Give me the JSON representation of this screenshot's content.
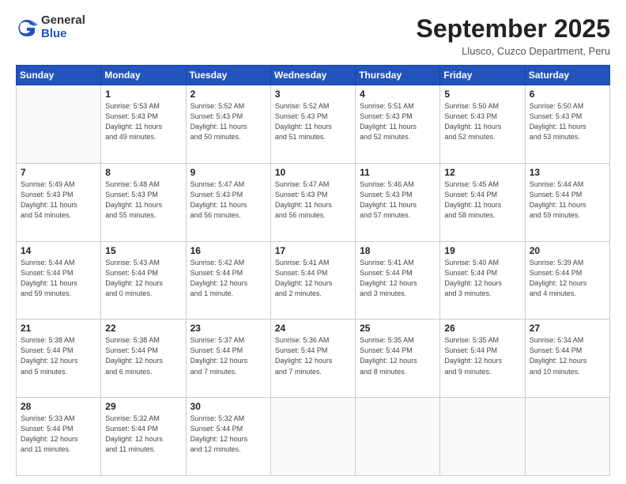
{
  "logo": {
    "general": "General",
    "blue": "Blue"
  },
  "header": {
    "month_title": "September 2025",
    "location": "Llusco, Cuzco Department, Peru"
  },
  "weekdays": [
    "Sunday",
    "Monday",
    "Tuesday",
    "Wednesday",
    "Thursday",
    "Friday",
    "Saturday"
  ],
  "weeks": [
    [
      {
        "day": "",
        "info": ""
      },
      {
        "day": "1",
        "info": "Sunrise: 5:53 AM\nSunset: 5:43 PM\nDaylight: 11 hours\nand 49 minutes."
      },
      {
        "day": "2",
        "info": "Sunrise: 5:52 AM\nSunset: 5:43 PM\nDaylight: 11 hours\nand 50 minutes."
      },
      {
        "day": "3",
        "info": "Sunrise: 5:52 AM\nSunset: 5:43 PM\nDaylight: 11 hours\nand 51 minutes."
      },
      {
        "day": "4",
        "info": "Sunrise: 5:51 AM\nSunset: 5:43 PM\nDaylight: 11 hours\nand 52 minutes."
      },
      {
        "day": "5",
        "info": "Sunrise: 5:50 AM\nSunset: 5:43 PM\nDaylight: 11 hours\nand 52 minutes."
      },
      {
        "day": "6",
        "info": "Sunrise: 5:50 AM\nSunset: 5:43 PM\nDaylight: 11 hours\nand 53 minutes."
      }
    ],
    [
      {
        "day": "7",
        "info": "Sunrise: 5:49 AM\nSunset: 5:43 PM\nDaylight: 11 hours\nand 54 minutes."
      },
      {
        "day": "8",
        "info": "Sunrise: 5:48 AM\nSunset: 5:43 PM\nDaylight: 11 hours\nand 55 minutes."
      },
      {
        "day": "9",
        "info": "Sunrise: 5:47 AM\nSunset: 5:43 PM\nDaylight: 11 hours\nand 56 minutes."
      },
      {
        "day": "10",
        "info": "Sunrise: 5:47 AM\nSunset: 5:43 PM\nDaylight: 11 hours\nand 56 minutes."
      },
      {
        "day": "11",
        "info": "Sunrise: 5:46 AM\nSunset: 5:43 PM\nDaylight: 11 hours\nand 57 minutes."
      },
      {
        "day": "12",
        "info": "Sunrise: 5:45 AM\nSunset: 5:44 PM\nDaylight: 11 hours\nand 58 minutes."
      },
      {
        "day": "13",
        "info": "Sunrise: 5:44 AM\nSunset: 5:44 PM\nDaylight: 11 hours\nand 59 minutes."
      }
    ],
    [
      {
        "day": "14",
        "info": "Sunrise: 5:44 AM\nSunset: 5:44 PM\nDaylight: 11 hours\nand 59 minutes."
      },
      {
        "day": "15",
        "info": "Sunrise: 5:43 AM\nSunset: 5:44 PM\nDaylight: 12 hours\nand 0 minutes."
      },
      {
        "day": "16",
        "info": "Sunrise: 5:42 AM\nSunset: 5:44 PM\nDaylight: 12 hours\nand 1 minute."
      },
      {
        "day": "17",
        "info": "Sunrise: 5:41 AM\nSunset: 5:44 PM\nDaylight: 12 hours\nand 2 minutes."
      },
      {
        "day": "18",
        "info": "Sunrise: 5:41 AM\nSunset: 5:44 PM\nDaylight: 12 hours\nand 3 minutes."
      },
      {
        "day": "19",
        "info": "Sunrise: 5:40 AM\nSunset: 5:44 PM\nDaylight: 12 hours\nand 3 minutes."
      },
      {
        "day": "20",
        "info": "Sunrise: 5:39 AM\nSunset: 5:44 PM\nDaylight: 12 hours\nand 4 minutes."
      }
    ],
    [
      {
        "day": "21",
        "info": "Sunrise: 5:38 AM\nSunset: 5:44 PM\nDaylight: 12 hours\nand 5 minutes."
      },
      {
        "day": "22",
        "info": "Sunrise: 5:38 AM\nSunset: 5:44 PM\nDaylight: 12 hours\nand 6 minutes."
      },
      {
        "day": "23",
        "info": "Sunrise: 5:37 AM\nSunset: 5:44 PM\nDaylight: 12 hours\nand 7 minutes."
      },
      {
        "day": "24",
        "info": "Sunrise: 5:36 AM\nSunset: 5:44 PM\nDaylight: 12 hours\nand 7 minutes."
      },
      {
        "day": "25",
        "info": "Sunrise: 5:35 AM\nSunset: 5:44 PM\nDaylight: 12 hours\nand 8 minutes."
      },
      {
        "day": "26",
        "info": "Sunrise: 5:35 AM\nSunset: 5:44 PM\nDaylight: 12 hours\nand 9 minutes."
      },
      {
        "day": "27",
        "info": "Sunrise: 5:34 AM\nSunset: 5:44 PM\nDaylight: 12 hours\nand 10 minutes."
      }
    ],
    [
      {
        "day": "28",
        "info": "Sunrise: 5:33 AM\nSunset: 5:44 PM\nDaylight: 12 hours\nand 11 minutes."
      },
      {
        "day": "29",
        "info": "Sunrise: 5:32 AM\nSunset: 5:44 PM\nDaylight: 12 hours\nand 11 minutes."
      },
      {
        "day": "30",
        "info": "Sunrise: 5:32 AM\nSunset: 5:44 PM\nDaylight: 12 hours\nand 12 minutes."
      },
      {
        "day": "",
        "info": ""
      },
      {
        "day": "",
        "info": ""
      },
      {
        "day": "",
        "info": ""
      },
      {
        "day": "",
        "info": ""
      }
    ]
  ]
}
